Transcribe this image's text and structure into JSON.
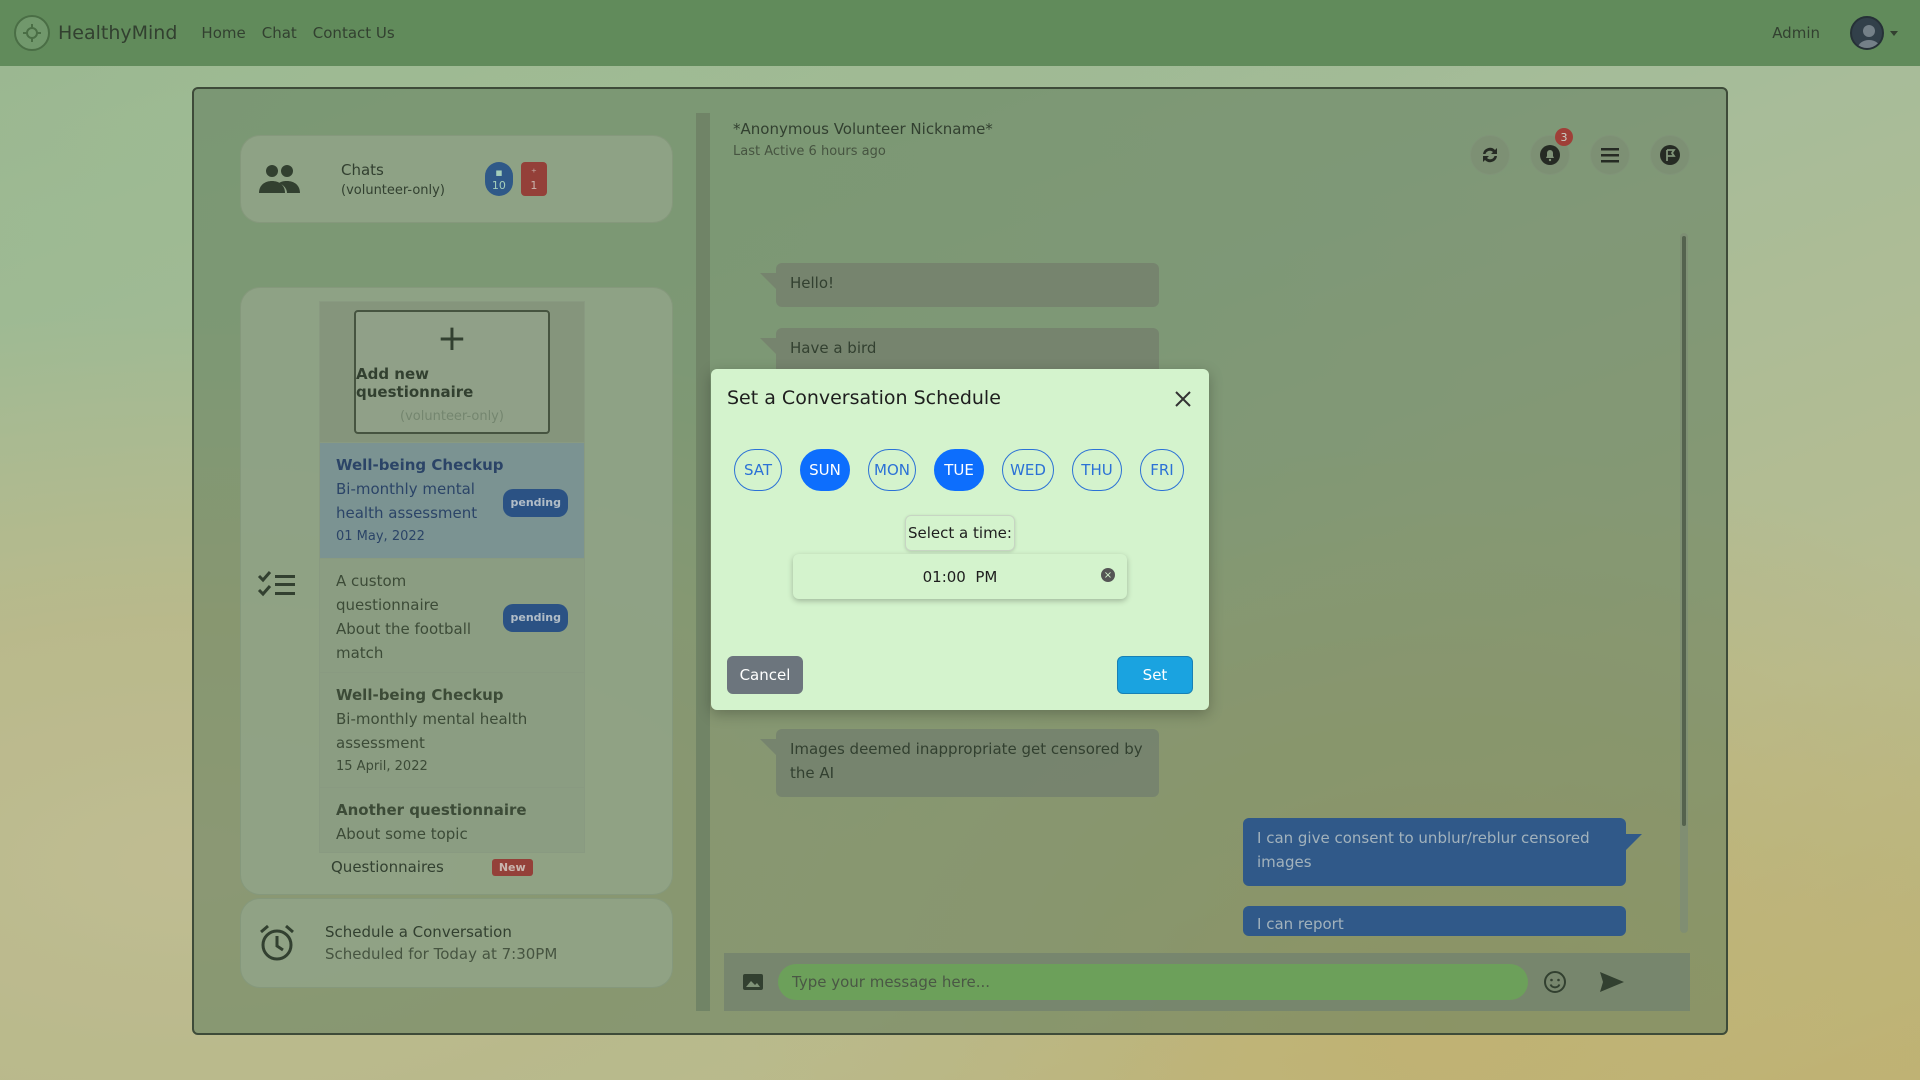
{
  "navbar": {
    "brand": "HealthyMind",
    "links": [
      "Home",
      "Chat",
      "Contact Us"
    ],
    "user": "Admin"
  },
  "chats_card": {
    "title": "Chats",
    "subtitle": "(volunteer-only)",
    "unread_count": "10",
    "request_count": "1"
  },
  "questionnaires": {
    "add_title": "Add new questionnaire",
    "add_subtitle": "(volunteer-only)",
    "items": [
      {
        "title": "Well-being Checkup",
        "description": "Bi-monthly mental health assessment",
        "date": "01 May, 2022",
        "status": "pending"
      },
      {
        "title": "A custom questionnaire",
        "description": "About the football match",
        "status": "pending"
      },
      {
        "title": "Well-being Checkup",
        "description": "Bi-monthly mental health assessment",
        "date": "15 April, 2022"
      },
      {
        "title": "Another questionnaire",
        "description": "About some topic"
      }
    ],
    "footer_label": "Questionnaires",
    "new_badge": "New"
  },
  "schedule_card": {
    "title": "Schedule a Conversation",
    "subtitle": "Scheduled for Today at 7:30PM"
  },
  "chat": {
    "name": "*Anonymous Volunteer Nickname*",
    "last_active": "Last Active 6 hours ago",
    "notification_count": "3",
    "messages": [
      {
        "side": "in",
        "text": "Hello!"
      },
      {
        "side": "in",
        "text": "Have a bird"
      },
      {
        "side": "in",
        "text": "Images deemed inappropriate get censored by the AI"
      },
      {
        "side": "out",
        "text": "I can give consent to unblur/reblur censored images"
      },
      {
        "side": "out",
        "text": "I can report"
      }
    ],
    "input_placeholder": "Type your message here..."
  },
  "modal": {
    "title": "Set a Conversation Schedule",
    "days": [
      {
        "label": "SAT",
        "selected": false
      },
      {
        "label": "SUN",
        "selected": true
      },
      {
        "label": "MON",
        "selected": false
      },
      {
        "label": "TUE",
        "selected": true
      },
      {
        "label": "WED",
        "selected": false
      },
      {
        "label": "THU",
        "selected": false
      },
      {
        "label": "FRI",
        "selected": false
      }
    ],
    "time_label": "Select a time:",
    "time_value": "01:00  PM",
    "cancel_label": "Cancel",
    "set_label": "Set"
  },
  "colors": {
    "navbar": "#6fa36a",
    "modal_bg": "#d4f3cd",
    "day_selected": "#0d6efd",
    "set_button": "#1aa3e0",
    "cancel_button": "#6c757d",
    "outgoing_message": "#2c5ea9",
    "badge_red": "#b63b3b"
  }
}
